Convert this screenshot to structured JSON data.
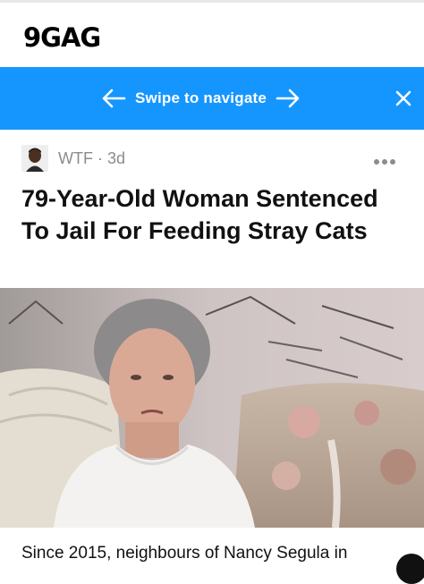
{
  "app": {
    "logo": "9GAG"
  },
  "banner": {
    "label": "Swipe to navigate",
    "color": "#1596ff"
  },
  "post": {
    "section": "WTF",
    "separator": "·",
    "age": "3d",
    "title": "79-Year-Old Woman Sentenced To Jail For Feeding Stray Cats",
    "body_preview": "Since 2015, neighbours of Nancy Segula in"
  },
  "icons": {
    "back": "arrow-left-icon",
    "forward": "arrow-right-icon",
    "close": "close-icon",
    "more": "more-dots-icon"
  }
}
